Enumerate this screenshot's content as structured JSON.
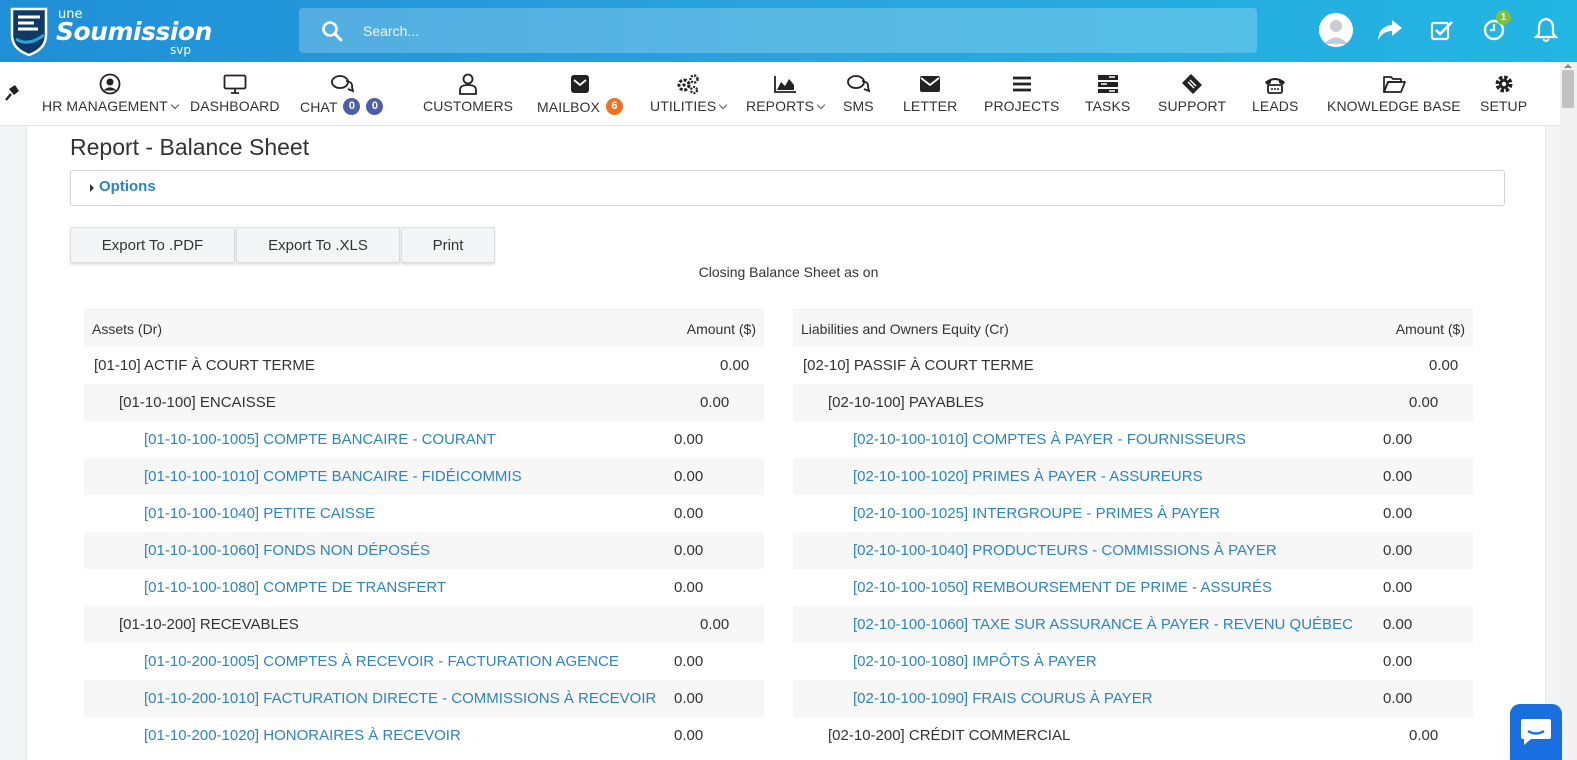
{
  "brand": {
    "top": "une",
    "main": "Soumission",
    "bottom": "svp"
  },
  "search": {
    "placeholder": "Search..."
  },
  "top_icons": {
    "notification_count": "1"
  },
  "nav": [
    {
      "id": "hr",
      "label": "HR MANAGEMENT",
      "icon": "user-circle-icon",
      "dropdown": true
    },
    {
      "id": "dashboard",
      "label": "DASHBOARD",
      "icon": "monitor-icon"
    },
    {
      "id": "chat",
      "label": "CHAT",
      "icon": "chat-bubbles-icon",
      "badges": [
        "0",
        "0"
      ]
    },
    {
      "id": "customers",
      "label": "CUSTOMERS",
      "icon": "user-outline-icon"
    },
    {
      "id": "mailbox",
      "label": "MAILBOX",
      "icon": "mailbox-icon",
      "badges": [
        "6"
      ]
    },
    {
      "id": "utilities",
      "label": "UTILITIES",
      "icon": "cogs-icon",
      "dropdown": true
    },
    {
      "id": "reports",
      "label": "REPORTS",
      "icon": "area-chart-icon",
      "dropdown": true
    },
    {
      "id": "sms",
      "label": "SMS",
      "icon": "sms-bubbles-icon"
    },
    {
      "id": "letter",
      "label": "LETTER",
      "icon": "envelope-icon"
    },
    {
      "id": "projects",
      "label": "PROJECTS",
      "icon": "bars-icon"
    },
    {
      "id": "tasks",
      "label": "TASKS",
      "icon": "tasks-icon"
    },
    {
      "id": "support",
      "label": "SUPPORT",
      "icon": "ticket-icon"
    },
    {
      "id": "leads",
      "label": "LEADS",
      "icon": "phone-icon"
    },
    {
      "id": "kb",
      "label": "KNOWLEDGE BASE",
      "icon": "folder-open-icon"
    },
    {
      "id": "setup",
      "label": "SETUP",
      "icon": "gear-icon"
    }
  ],
  "colors": {
    "accent": "#2b84c6",
    "badge_blue": "#4c5fa8",
    "badge_orange": "#f2711c",
    "header_start": "#1f8fd6",
    "header_end": "#22b6e3"
  },
  "page": {
    "title": "Report - Balance Sheet",
    "options_label": "Options",
    "buttons": {
      "pdf": "Export To .PDF",
      "xls": "Export To .XLS",
      "print": "Print"
    },
    "subtitle": "Closing Balance Sheet as on"
  },
  "assets": {
    "header_label": "Assets (Dr)",
    "header_amount": "Amount ($)",
    "rows": [
      {
        "level": 0,
        "label": "[01-10] ACTIF À COURT TERME",
        "amount": "0.00",
        "link": false
      },
      {
        "level": 1,
        "label": "[01-10-100] ENCAISSE",
        "amount": "0.00",
        "link": false
      },
      {
        "level": 2,
        "label": "[01-10-100-1005] COMPTE BANCAIRE - COURANT",
        "amount": "0.00",
        "link": true
      },
      {
        "level": 2,
        "label": "[01-10-100-1010] COMPTE BANCAIRE - FIDÉICOMMIS",
        "amount": "0.00",
        "link": true
      },
      {
        "level": 2,
        "label": "[01-10-100-1040] PETITE CAISSE",
        "amount": "0.00",
        "link": true
      },
      {
        "level": 2,
        "label": "[01-10-100-1060] FONDS NON DÉPOSÉS",
        "amount": "0.00",
        "link": true
      },
      {
        "level": 2,
        "label": "[01-10-100-1080] COMPTE DE TRANSFERT",
        "amount": "0.00",
        "link": true
      },
      {
        "level": 1,
        "label": "[01-10-200] RECEVABLES",
        "amount": "0.00",
        "link": false
      },
      {
        "level": 2,
        "label": "[01-10-200-1005] COMPTES À RECEVOIR - FACTURATION AGENCE",
        "amount": "0.00",
        "link": true
      },
      {
        "level": 2,
        "label": "[01-10-200-1010] FACTURATION DIRECTE - COMMISSIONS À RECEVOIR",
        "amount": "0.00",
        "link": true
      },
      {
        "level": 2,
        "label": "[01-10-200-1020] HONORAIRES À RECEVOIR",
        "amount": "0.00",
        "link": true
      }
    ]
  },
  "liabilities": {
    "header_label": "Liabilities and Owners Equity (Cr)",
    "header_amount": "Amount ($)",
    "rows": [
      {
        "level": 0,
        "label": "[02-10] PASSIF À COURT TERME",
        "amount": "0.00",
        "link": false
      },
      {
        "level": 1,
        "label": "[02-10-100] PAYABLES",
        "amount": "0.00",
        "link": false
      },
      {
        "level": 2,
        "label": "[02-10-100-1010] COMPTES À PAYER - FOURNISSEURS",
        "amount": "0.00",
        "link": true
      },
      {
        "level": 2,
        "label": "[02-10-100-1020] PRIMES À PAYER - ASSUREURS",
        "amount": "0.00",
        "link": true
      },
      {
        "level": 2,
        "label": "[02-10-100-1025] INTERGROUPE - PRIMES À PAYER",
        "amount": "0.00",
        "link": true
      },
      {
        "level": 2,
        "label": "[02-10-100-1040] PRODUCTEURS - COMMISSIONS À PAYER",
        "amount": "0.00",
        "link": true
      },
      {
        "level": 2,
        "label": "[02-10-100-1050] REMBOURSEMENT DE PRIME - ASSURÉS",
        "amount": "0.00",
        "link": true
      },
      {
        "level": 2,
        "label": "[02-10-100-1060] TAXE SUR ASSURANCE À PAYER - REVENU QUÉBEC",
        "amount": "0.00",
        "link": true
      },
      {
        "level": 2,
        "label": "[02-10-100-1080] IMPÔTS À PAYER",
        "amount": "0.00",
        "link": true
      },
      {
        "level": 2,
        "label": "[02-10-100-1090] FRAIS COURUS À PAYER",
        "amount": "0.00",
        "link": true
      },
      {
        "level": 1,
        "label": "[02-10-200] CRÉDIT COMMERCIAL",
        "amount": "0.00",
        "link": false
      }
    ]
  }
}
